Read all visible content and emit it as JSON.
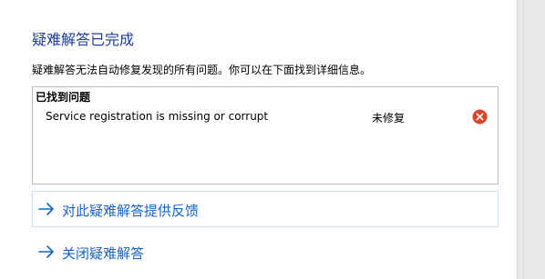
{
  "title": "疑难解答已完成",
  "description": "疑难解答无法自动修复发现的所有问题。你可以在下面找到详细信息。",
  "problems": {
    "header": "已找到问题",
    "items": [
      {
        "name": "Service registration is missing or corrupt",
        "status": "未修复",
        "status_icon": "error-x-icon"
      }
    ]
  },
  "links": {
    "feedback": "对此疑难解答提供反馈",
    "close": "关闭疑难解答"
  },
  "colors": {
    "title": "#1e3c96",
    "link": "#1565c0",
    "error": "#d9452b"
  }
}
